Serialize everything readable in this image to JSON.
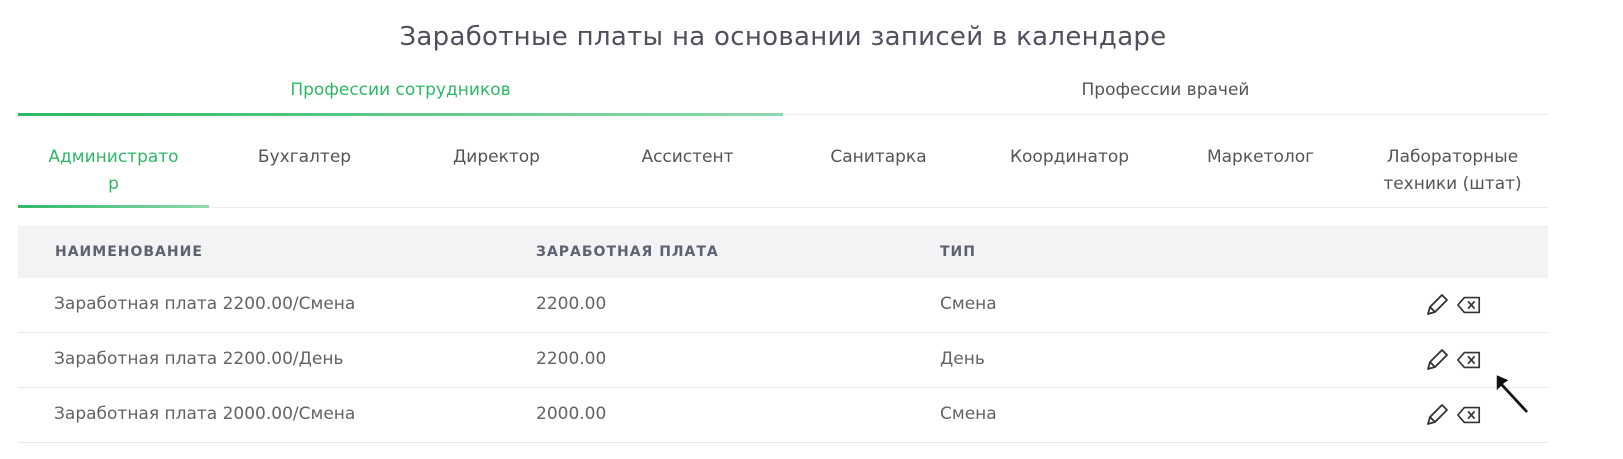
{
  "page": {
    "title": "Заработные платы на основании записей в календаре"
  },
  "main_tabs": [
    {
      "label": "Профессии сотрудников",
      "active": true
    },
    {
      "label": "Профессии врачей",
      "active": false
    }
  ],
  "profession_tabs": [
    {
      "label": "Администрато\nр",
      "active": true
    },
    {
      "label": "Бухгалтер",
      "active": false
    },
    {
      "label": "Директор",
      "active": false
    },
    {
      "label": "Ассистент",
      "active": false
    },
    {
      "label": "Санитарка",
      "active": false
    },
    {
      "label": "Координатор",
      "active": false
    },
    {
      "label": "Маркетолог",
      "active": false
    },
    {
      "label": "Лабораторные\nтехники (штат)",
      "active": false
    }
  ],
  "table": {
    "columns": {
      "name": "НАИМЕНОВАНИЕ",
      "salary": "ЗАРАБОТНАЯ ПЛАТА",
      "type": "ТИП"
    },
    "rows": [
      {
        "name": "Заработная плата 2200.00/Смена",
        "salary": "2200.00",
        "type": "Смена"
      },
      {
        "name": "Заработная плата 2200.00/День",
        "salary": "2200.00",
        "type": "День"
      },
      {
        "name": "Заработная плата 2000.00/Смена",
        "salary": "2000.00",
        "type": "Смена"
      }
    ]
  },
  "icons": {
    "edit": "pencil-icon",
    "delete": "backspace-x-icon",
    "pointer": "mouse-cursor-icon"
  },
  "colors": {
    "accent": "#2eb866",
    "header_bg": "#f3f3f5",
    "text": "#636363"
  }
}
